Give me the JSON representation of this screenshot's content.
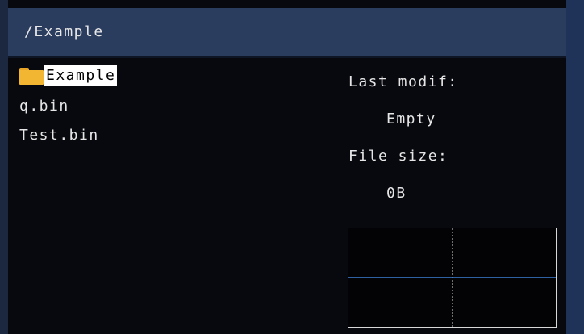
{
  "path_bar": {
    "path": "/Example"
  },
  "file_list": {
    "items": [
      {
        "label": "Example",
        "type": "folder",
        "icon": "folder-icon",
        "selected": true
      },
      {
        "label": "q.bin",
        "type": "file",
        "selected": false
      },
      {
        "label": "Test.bin",
        "type": "file",
        "selected": false
      }
    ]
  },
  "info_panel": {
    "last_modified_label": "Last modif:",
    "last_modified_value": "Empty",
    "file_size_label": "File size:",
    "file_size_value": "0B"
  },
  "colors": {
    "path_bar_background": "#2b3d5f",
    "selection_background": "#ffffff",
    "folder_icon": "#f2b632",
    "preview_trace": "#3d7fd6",
    "preview_grid": "#d8d8d8"
  }
}
